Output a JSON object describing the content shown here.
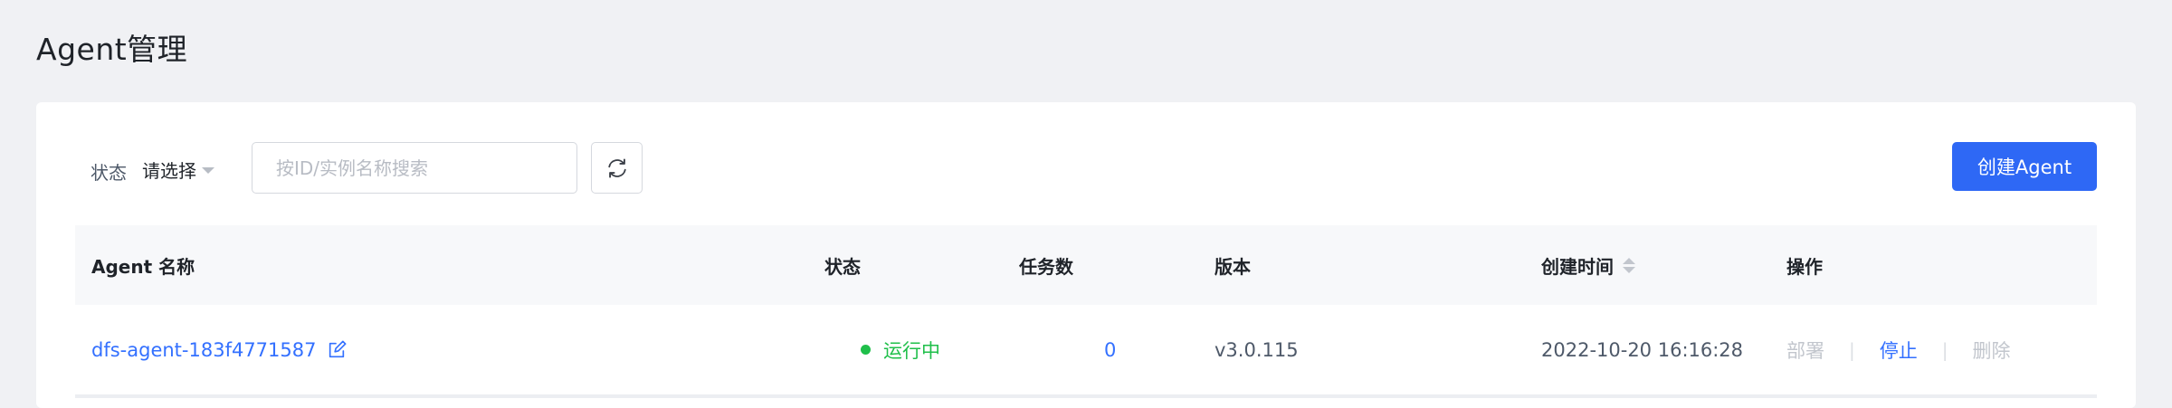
{
  "page": {
    "title": "Agent管理"
  },
  "toolbar": {
    "status_label": "状态",
    "status_value": "请选择",
    "search_placeholder": "按ID/实例名称搜索",
    "refresh_icon": "refresh-icon",
    "create_label": "创建Agent"
  },
  "table": {
    "columns": {
      "name": "Agent 名称",
      "status": "状态",
      "tasks": "任务数",
      "version": "版本",
      "created": "创建时间",
      "actions": "操作"
    },
    "rows": [
      {
        "name": "dfs-agent-183f4771587",
        "status": "运行中",
        "status_color": "#1fbf4a",
        "tasks": "0",
        "version": "v3.0.115",
        "created": "2022-10-20 16:16:28",
        "actions": {
          "deploy": "部署",
          "stop": "停止",
          "delete": "删除"
        }
      }
    ]
  },
  "colors": {
    "accent": "#2e68f5",
    "link": "#3370ff",
    "success": "#1fbf4a",
    "page_bg": "#f0f1f4"
  }
}
